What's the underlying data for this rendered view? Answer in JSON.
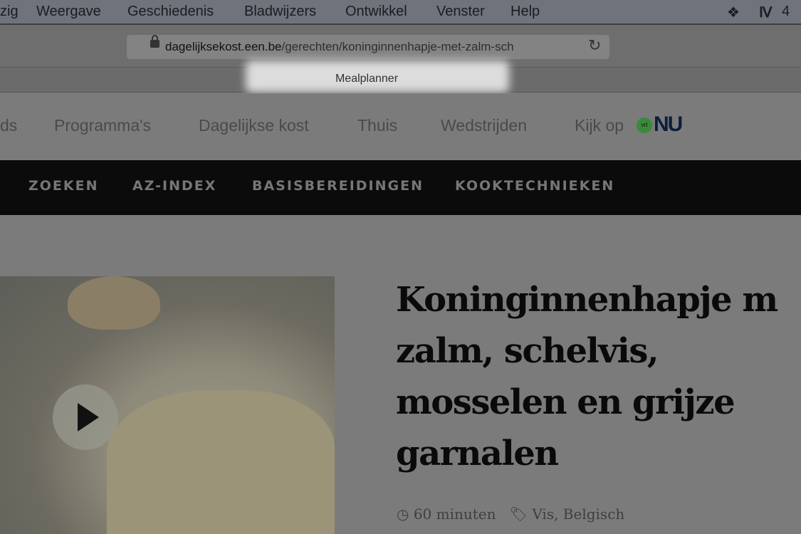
{
  "menubar": {
    "items": [
      "zig",
      "Weergave",
      "Geschiedenis",
      "Bladwijzers",
      "Ontwikkel",
      "Venster",
      "Help"
    ],
    "status_count": "4"
  },
  "toolbar": {
    "url_domain": "dagelijksekost.een.be",
    "url_path": "/gerechten/koninginnenhapje-met-zalm-sch"
  },
  "bookmarks": {
    "item": "Mealplanner"
  },
  "site_header": {
    "items": [
      "ds",
      "Programma's",
      "Dagelijkse kost",
      "Thuis",
      "Wedstrijden",
      "Kijk op"
    ],
    "logo_vrt": "vrt",
    "logo_nu": "NU"
  },
  "nav": {
    "items": [
      "ZOEKEN",
      "AZ-INDEX",
      "BASISBEREIDINGEN",
      "KOOKTECHNIEKEN"
    ]
  },
  "recipe": {
    "title_lines": [
      "Koninginnenhapje m",
      "zalm, schelvis,",
      "mosselen en grijze",
      "garnalen"
    ],
    "duration": "60 minuten",
    "tags": "Vis, Belgisch"
  }
}
